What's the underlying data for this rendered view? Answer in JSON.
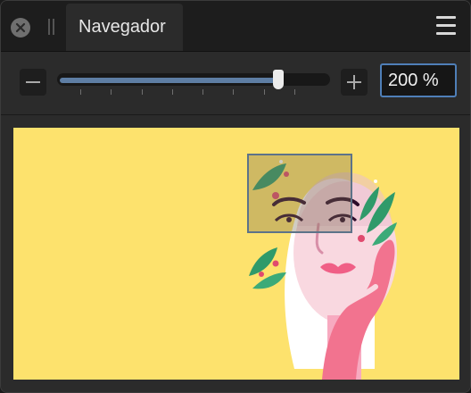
{
  "panel": {
    "tab_label": "Navegador"
  },
  "zoom": {
    "slider_fraction": 0.81,
    "tick_count": 8,
    "field_value": "200 %"
  },
  "icons": {
    "close": "close-icon",
    "grip": "drag-grip-icon",
    "menu": "hamburger-menu-icon",
    "zoom_out": "minus-icon",
    "zoom_in": "plus-icon"
  },
  "colors": {
    "accent": "#4f7fb8",
    "slider_fill": "#5e7ea4",
    "preview_background": "#fde26d"
  }
}
